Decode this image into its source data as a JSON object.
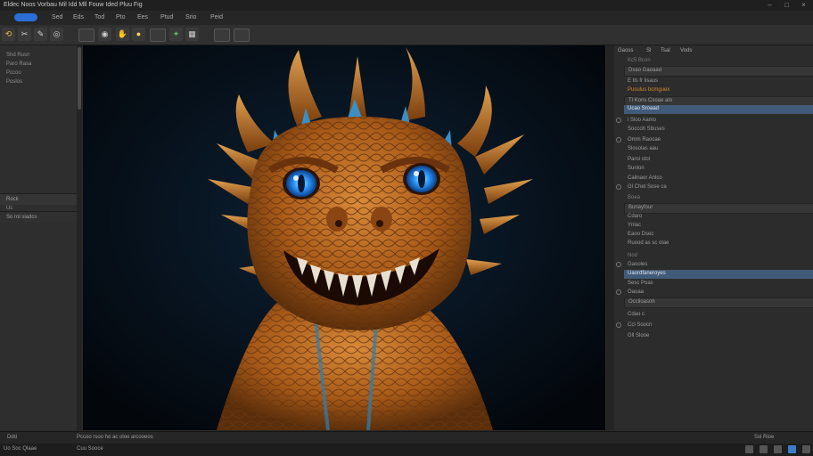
{
  "window": {
    "title": "Eldec  Noos  Vorbau  Mil Idd Mll Fouw Ided  Pluu  Fig",
    "controls": [
      "minimize",
      "maximize",
      "close"
    ]
  },
  "menu": {
    "items": [
      "Sed",
      "Eds",
      "Tod",
      "Pto",
      "Ees",
      "Ptud",
      "Srio",
      "Peid"
    ]
  },
  "toolbar": {
    "tools": [
      "rotate-icon",
      "crop-icon",
      "brush-icon",
      "stamp-icon",
      "eye-icon",
      "hand-icon",
      "zoom-icon",
      "wand-icon",
      "layer-icon",
      "grid-icon",
      "image-icon",
      "export-icon"
    ]
  },
  "left_panel": {
    "items": [
      "Shd Rusn",
      "Paro Rasa",
      "Pccoo",
      "Poslos"
    ],
    "section": {
      "header": "Rock",
      "sub": "Uc",
      "item": "So rol siadcs"
    }
  },
  "canvas": {
    "subject": "orange dragon portrait",
    "palette": {
      "background": "#060c14",
      "scales": "#b8641c",
      "horns": "#c97a2a",
      "eyes": "#2f9cff",
      "spikes": "#3a8fc4"
    }
  },
  "right_panel": {
    "tabs": [
      "Gaoss",
      "Sl",
      "Tsal",
      "Vods"
    ],
    "rows": [
      {
        "label": "Kc5 Bcon",
        "style": "dim"
      },
      {
        "label": "Dxao Gaoaad",
        "style": "field"
      },
      {
        "label": "E tls fr lisaus",
        "style": "plain"
      },
      {
        "label": "Pusulus bcmguex",
        "style": "orange"
      },
      {
        "label": "Tl Kons Cxoae alo",
        "style": "field"
      },
      {
        "label": "Ucao Sroaad",
        "style": "sel"
      },
      {
        "label": "i Sloo Aamo",
        "style": "plain"
      },
      {
        "label": "Soccoh Sbuses",
        "style": "plain"
      },
      {
        "label": "Omm Raocae",
        "style": "plain"
      },
      {
        "label": "Slosolas aau",
        "style": "plain"
      },
      {
        "label": "Paroi stol",
        "style": "plain"
      },
      {
        "label": "Sunlon",
        "style": "plain"
      },
      {
        "label": "Calinaor Anlco",
        "style": "plain"
      },
      {
        "label": "Gl Chet  Sose  ca",
        "style": "plain"
      },
      {
        "label": "Boea",
        "style": "dim"
      },
      {
        "label": "Bunayfour",
        "style": "field"
      },
      {
        "label": "Cdaro",
        "style": "plain"
      },
      {
        "label": "Ynlac",
        "style": "plain"
      },
      {
        "label": "Eaoo Dsec",
        "style": "plain"
      },
      {
        "label": "Ruood as sc olae",
        "style": "plain"
      },
      {
        "label": "Nod",
        "style": "dim"
      },
      {
        "label": "Gaooles",
        "style": "plain"
      },
      {
        "label": "Uaordfaneroyes",
        "style": "sel"
      },
      {
        "label": "Sesc Poas",
        "style": "plain"
      },
      {
        "label": "Oaoaa",
        "style": "plain"
      },
      {
        "label": "Occlioasoh",
        "style": "field"
      },
      {
        "label": "Cdao c",
        "style": "plain"
      },
      {
        "label": "Ccl Soocn",
        "style": "plain"
      },
      {
        "label": "Gll Slooe",
        "style": "plain"
      }
    ]
  },
  "status_bar": {
    "left": "Ddd",
    "center": "Pccoo  rsoo  ho  ac oloo arcooeos",
    "right": "Ssl Rioe"
  },
  "taskbar": {
    "left": "Uo  Soc Qlaae",
    "center": "Cuu Sooce"
  }
}
